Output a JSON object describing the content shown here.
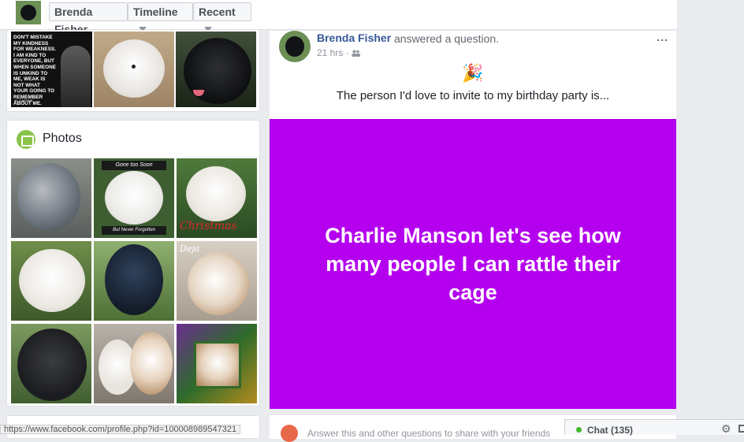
{
  "topbar": {
    "profile_name": "Brenda Fisher",
    "timeline_label": "Timeline",
    "recent_label": "Recent"
  },
  "left": {
    "meme_text": "DON'T MISTAKE MY KINDNESS FOR WEAKNESS. I AM KIND TO EVERYONE, BUT WHEN SOMEONE IS UNKIND TO ME, WEAK IS NOT WHAT YOUR GOING TO REMEMBER ABOUT ME.",
    "meme_attribution": "AL CAPONE",
    "photos_title": "Photos",
    "photo_captions": {
      "gone_top": "Gone too Soon",
      "gone_bottom": "But Never Forgotten",
      "christmas": "Christmas",
      "deja": "Deja"
    }
  },
  "post": {
    "author": "Brenda Fisher",
    "action": "answered a question.",
    "time": "21 hrs",
    "more_label": "...",
    "question": "The person I'd love to invite to my birthday party is...",
    "answer": "Charlie Manson let's see how many people I can rattle their cage",
    "answer_bg": "#b400ee"
  },
  "bottom": {
    "prompt": "Answer this and other questions to share with your friends"
  },
  "status_url": "https://www.facebook.com/profile.php?id=100008989547321",
  "chat": {
    "label": "Chat (135)"
  },
  "icons": [
    "party-popper-icon",
    "friends-audience-icon",
    "photos-icon",
    "gear-icon",
    "compose-icon"
  ],
  "colors": {
    "link": "#365899",
    "accent": "#b400ee",
    "online": "#42b72a"
  }
}
